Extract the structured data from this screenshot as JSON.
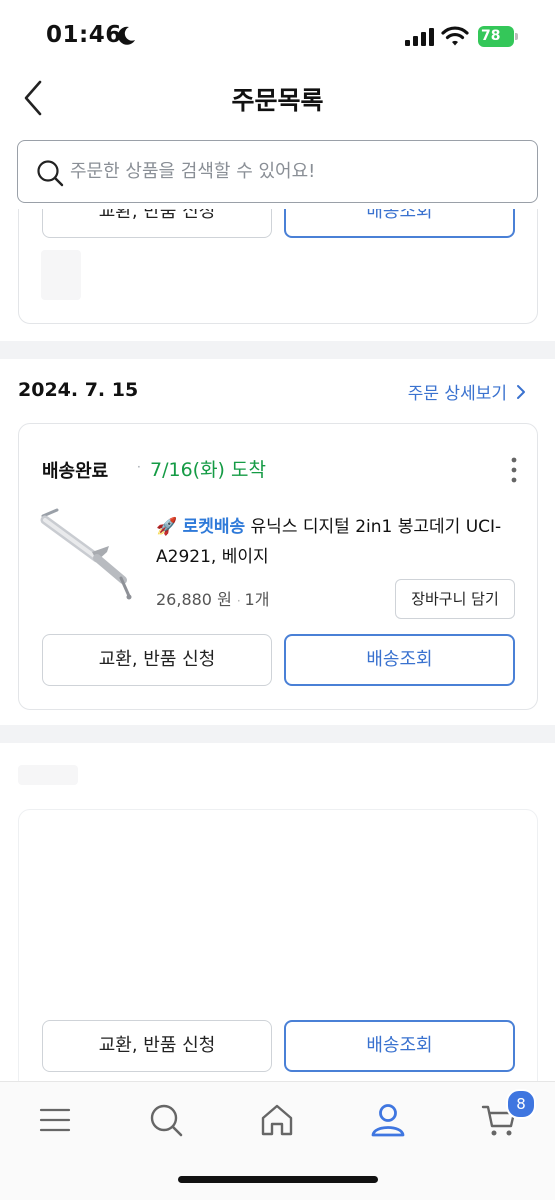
{
  "status_bar": {
    "time": "01:46",
    "battery": "78"
  },
  "header": {
    "title": "주문목록"
  },
  "search": {
    "placeholder": "주문한 상품을 검색할 수 있어요!"
  },
  "prev_card": {
    "exchange_label": "교환, 반품 신청",
    "track_label": "배송조회"
  },
  "order": {
    "date": "2024. 7. 15",
    "detail_link": "주문 상세보기",
    "status": "배송완료",
    "arrival": "7/16(화) 도착",
    "product": {
      "badge": "로켓배송",
      "name": "유닉스 디지털 2in1 봉고데기 UCI-A2921, 베이지",
      "price": "26,880 원",
      "quantity": "1개",
      "cart_label": "장바구니 담기"
    },
    "exchange_label": "교환, 반품 신청",
    "track_label": "배송조회"
  },
  "next_card": {
    "exchange_label": "교환, 반품 신청",
    "track_label": "배송조회"
  },
  "bottom_nav": {
    "items": [
      "menu-icon",
      "search-icon",
      "home-icon",
      "user-icon",
      "cart-icon"
    ],
    "cart_count": "8",
    "active_color": "#3f76e0"
  }
}
